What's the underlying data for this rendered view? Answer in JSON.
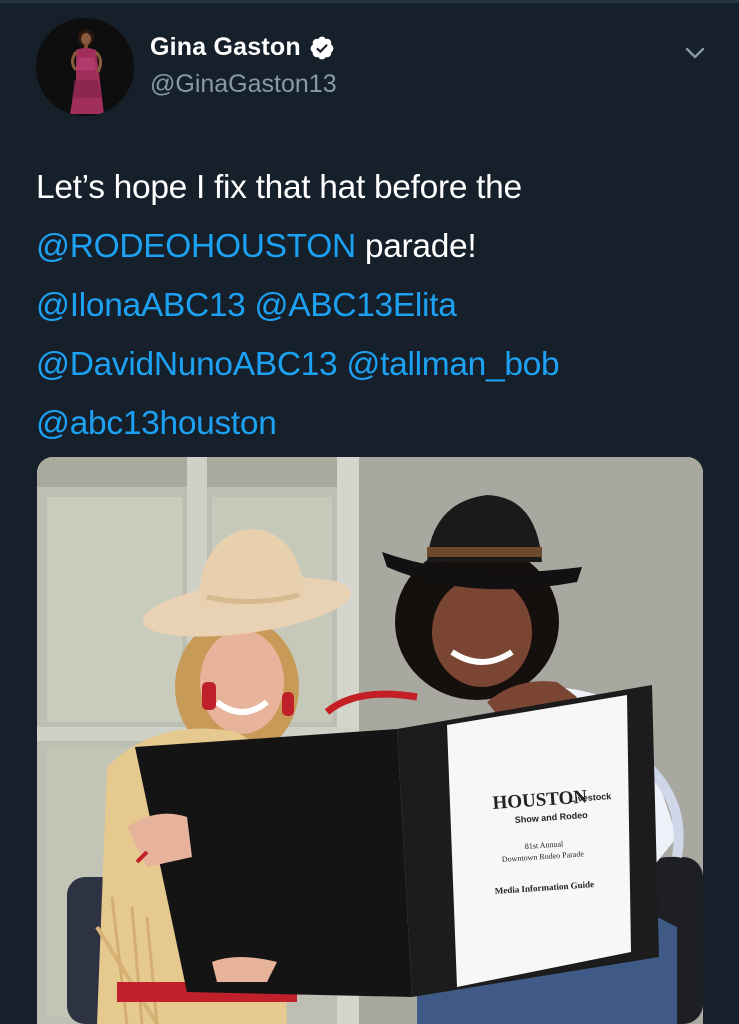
{
  "tweet": {
    "display_name": "Gina Gaston",
    "handle": "@GinaGaston13",
    "verified": true,
    "text_line1": "Let’s hope I fix that hat before the",
    "mention_rodeo": "@RODEOHOUSTON",
    "text_parade": " parade!",
    "mention_ilona": "@IlonaABC13",
    "mention_elita": "@ABC13Elita",
    "mention_david": "@DavidNunoABC13",
    "mention_bob": "@tallman_bob",
    "mention_abc13": "@abc13houston"
  },
  "photo": {
    "logo_main": "HOUSTON",
    "logo_sub1": "Livestock",
    "logo_sub2": "Show and Rodeo",
    "page_line1": "81st Annual",
    "page_line2": "Downtown Rodeo Parade",
    "page_title": "Media Information Guide"
  },
  "icons": {
    "verified": "verified-badge-icon",
    "menu": "chevron-down-icon"
  },
  "colors": {
    "background": "#15202b",
    "link": "#1da1f2",
    "secondary_text": "#8899a6",
    "text": "#ffffff"
  }
}
